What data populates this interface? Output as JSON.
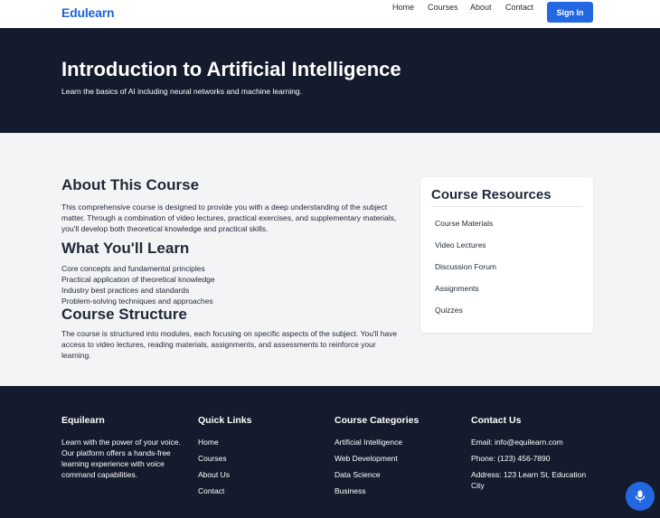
{
  "header": {
    "logo": "Edulearn",
    "nav": [
      "Home",
      "Courses",
      "About",
      "Contact"
    ],
    "signin_label": "Sign In"
  },
  "hero": {
    "title": "Introduction to Artificial Intelligence",
    "subtitle": "Learn the basics of AI including neural networks and machine learning."
  },
  "about": {
    "heading": "About This Course",
    "text": "This comprehensive course is designed to provide you with a deep understanding of the subject matter. Through a combination of video lectures, practical exercises, and supplementary materials, you'll develop both theoretical knowledge and practical skills."
  },
  "learn": {
    "heading": "What You'll Learn",
    "items": [
      "Core concepts and fundamental principles",
      "Practical application of theoretical knowledge",
      "Industry best practices and standards",
      "Problem-solving techniques and approaches"
    ]
  },
  "structure": {
    "heading": "Course Structure",
    "text": "The course is structured into modules, each focusing on specific aspects of the subject. You'll have access to video lectures, reading materials, assignments, and assessments to reinforce your learning."
  },
  "resources": {
    "heading": "Course Resources",
    "items": [
      "Course Materials",
      "Video Lectures",
      "Discussion Forum",
      "Assignments",
      "Quizzes"
    ]
  },
  "footer": {
    "brand": {
      "heading": "Equilearn",
      "text": "Learn with the power of your voice. Our platform offers a hands-free learning experience with voice command capabilities."
    },
    "quick_links": {
      "heading": "Quick Links",
      "items": [
        "Home",
        "Courses",
        "About Us",
        "Contact"
      ]
    },
    "categories": {
      "heading": "Course Categories",
      "items": [
        "Artificial Intelligence",
        "Web Development",
        "Data Science",
        "Business"
      ]
    },
    "contact": {
      "heading": "Contact Us",
      "email": "Email: info@equilearn.com",
      "phone": "Phone: (123) 456-7890",
      "address": "Address: 123 Learn St, Education City"
    }
  },
  "mic_icon": "microphone-icon",
  "colors": {
    "brand": "#2368e1",
    "dark": "#141b2c",
    "section_bg": "#f3f4f6"
  }
}
